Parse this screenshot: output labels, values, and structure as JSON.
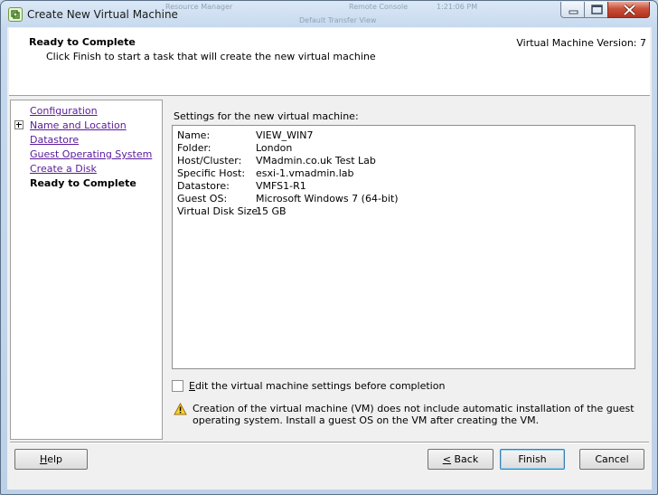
{
  "window": {
    "title": "Create New Virtual Machine",
    "background_taskbar_text": [
      "Resource Manager",
      "Remote Console",
      "1:21:06 PM",
      "Default Transfer View"
    ]
  },
  "header": {
    "title": "Ready to Complete",
    "subtitle": "Click Finish to start a task that will create the new virtual machine",
    "version": "Virtual Machine Version: 7"
  },
  "nav": {
    "items": [
      {
        "label": "Configuration",
        "state": "link"
      },
      {
        "label": "Name and Location",
        "state": "link",
        "expandable": true
      },
      {
        "label": "Datastore",
        "state": "link"
      },
      {
        "label": "Guest Operating System",
        "state": "link"
      },
      {
        "label": "Create a Disk",
        "state": "link"
      },
      {
        "label": "Ready to Complete",
        "state": "current"
      }
    ]
  },
  "settings": {
    "label": "Settings for the new virtual machine:",
    "rows": [
      {
        "key": "Name:",
        "value": "VIEW_WIN7"
      },
      {
        "key": "Folder:",
        "value": "London"
      },
      {
        "key": "Host/Cluster:",
        "value": "VMadmin.co.uk Test Lab"
      },
      {
        "key": "Specific Host:",
        "value": "esxi-1.vmadmin.lab"
      },
      {
        "key": "Datastore:",
        "value": "VMFS1-R1"
      },
      {
        "key": "Guest OS:",
        "value": "Microsoft Windows 7 (64-bit)"
      },
      {
        "key": "Virtual Disk Size:",
        "value": "15 GB"
      }
    ]
  },
  "options": {
    "edit_settings": {
      "prefix": "",
      "accel": "E",
      "rest": "dit the virtual machine settings before completion",
      "checked": false
    }
  },
  "warning": {
    "icon": "warning-triangle-icon",
    "text": "Creation of the virtual machine (VM) does not include automatic installation of the guest operating system. Install a guest OS on the VM after creating the VM."
  },
  "buttons": {
    "help": {
      "accel": "H",
      "rest": "elp"
    },
    "back": {
      "accel": "<",
      "rest": " Back"
    },
    "finish": "Finish",
    "cancel": "Cancel"
  },
  "colors": {
    "link": "#5a1a9a",
    "accent": "#3c7fb1"
  }
}
